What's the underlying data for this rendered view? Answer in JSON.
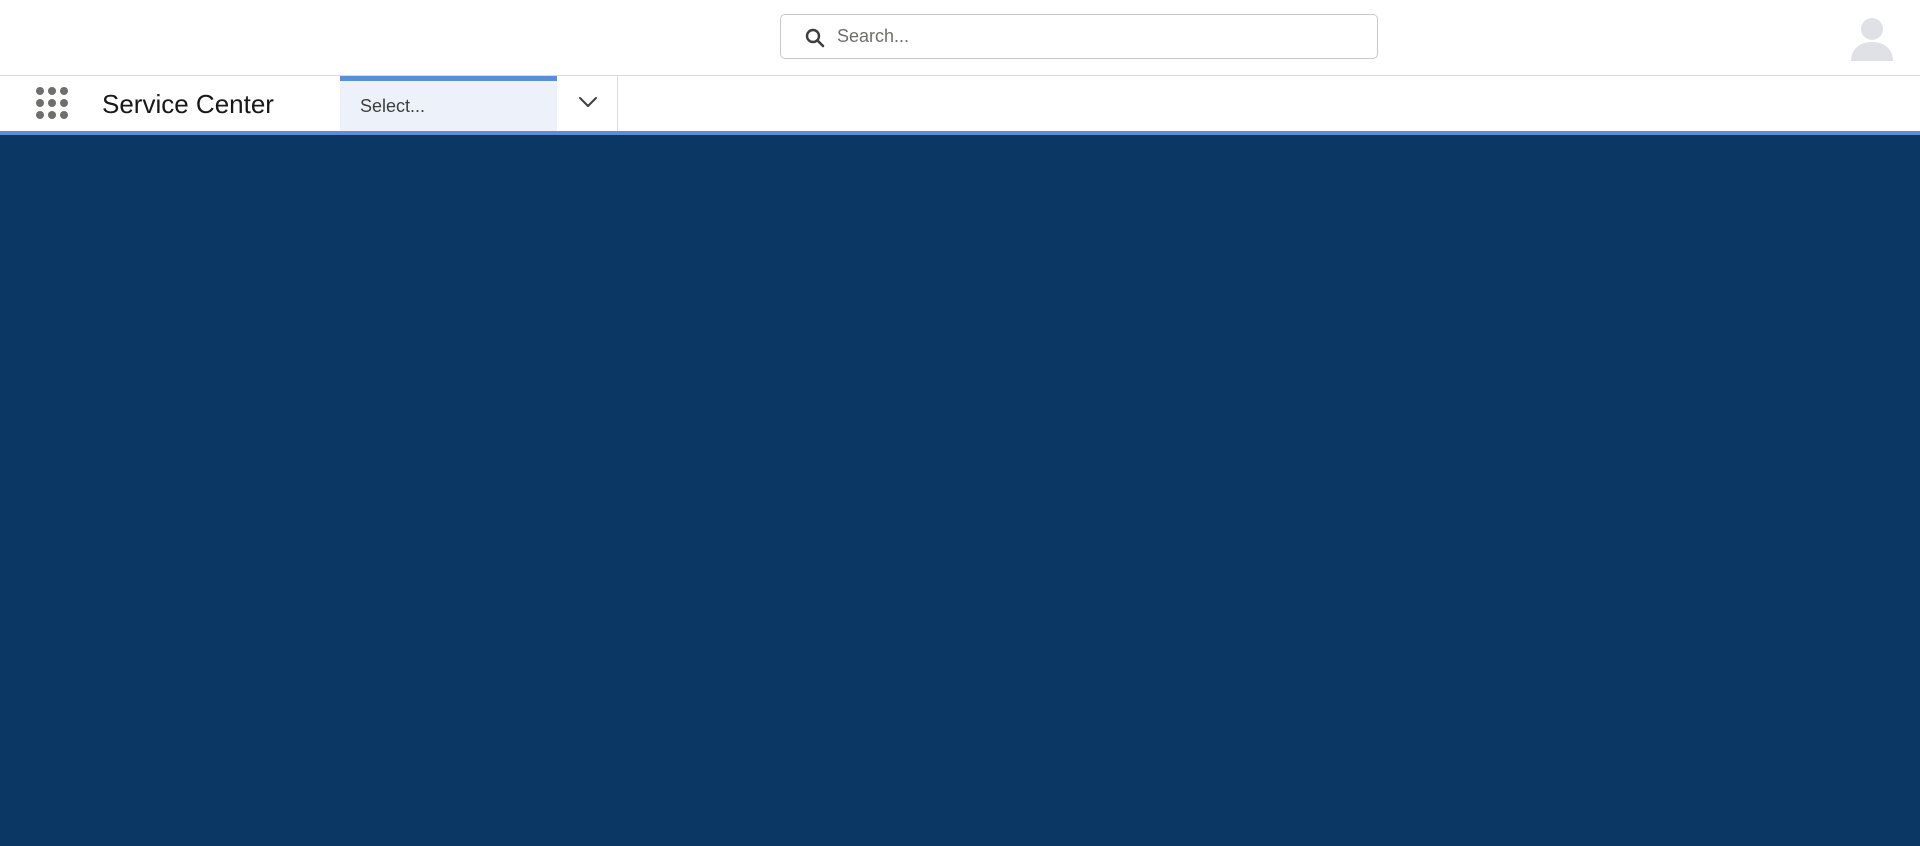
{
  "header": {
    "search": {
      "placeholder": "Search...",
      "value": ""
    },
    "avatar_icon": "user-avatar-icon"
  },
  "navbar": {
    "app_launcher_icon": "app-launcher-grid-icon",
    "app_name": "Service Center",
    "nav_select": {
      "label": "Select..."
    },
    "chevron_icon": "chevron-down-icon"
  },
  "colors": {
    "main_background": "#0b3765",
    "accent": "#5b8ed6",
    "nav_select_background": "#edf2fa",
    "icon_gray": "#706e6b"
  }
}
